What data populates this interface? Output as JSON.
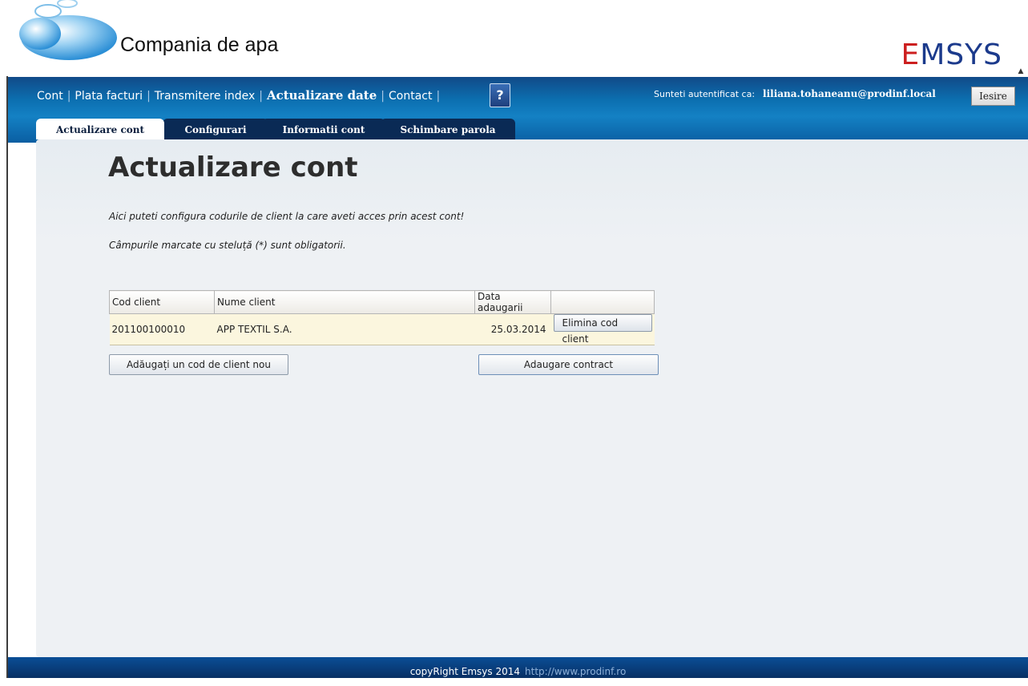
{
  "header": {
    "brand_title": "Compania de apa",
    "logo_prefix": "E",
    "logo_rest": "MSYS"
  },
  "nav": {
    "items": [
      "Cont",
      "Plata facturi",
      "Transmitere index",
      "Actualizare date",
      "Contact"
    ],
    "active": "Actualizare date",
    "help_label": "?",
    "auth_label": "Sunteti autentificat ca:",
    "user": "liliana.tohaneanu@prodinf.local",
    "logout_label": "Iesire"
  },
  "tabs": [
    "Actualizare cont",
    "Configurari",
    "Informatii cont",
    "Schimbare parola"
  ],
  "page": {
    "title": "Actualizare cont",
    "desc1": "Aici puteti configura codurile de client la care aveti acces prin acest cont!",
    "desc2": "Câmpurile marcate cu steluță (*) sunt obligatorii."
  },
  "table": {
    "headers": [
      "Cod client",
      "Nume client",
      "Data adaugarii",
      ""
    ],
    "rows": [
      {
        "code": "201100100010",
        "name": "APP TEXTIL S.A.",
        "date": "25.03.2014",
        "action": "Elimina cod client"
      }
    ]
  },
  "buttons": {
    "add_code": "Adăugați un cod de client nou",
    "add_contract": "Adaugare contract"
  },
  "footer": {
    "copyright": "copyRight Emsys 2014",
    "url": "http://www.prodinf.ro"
  },
  "colors": {
    "nav_blue": "#0c6fb0",
    "tab_dark": "#0a2a55",
    "panel_bg": "#eef1f4",
    "row_bg": "#fbf6de",
    "logo_red": "#cc1f1f",
    "logo_blue": "#1b3a8c"
  }
}
